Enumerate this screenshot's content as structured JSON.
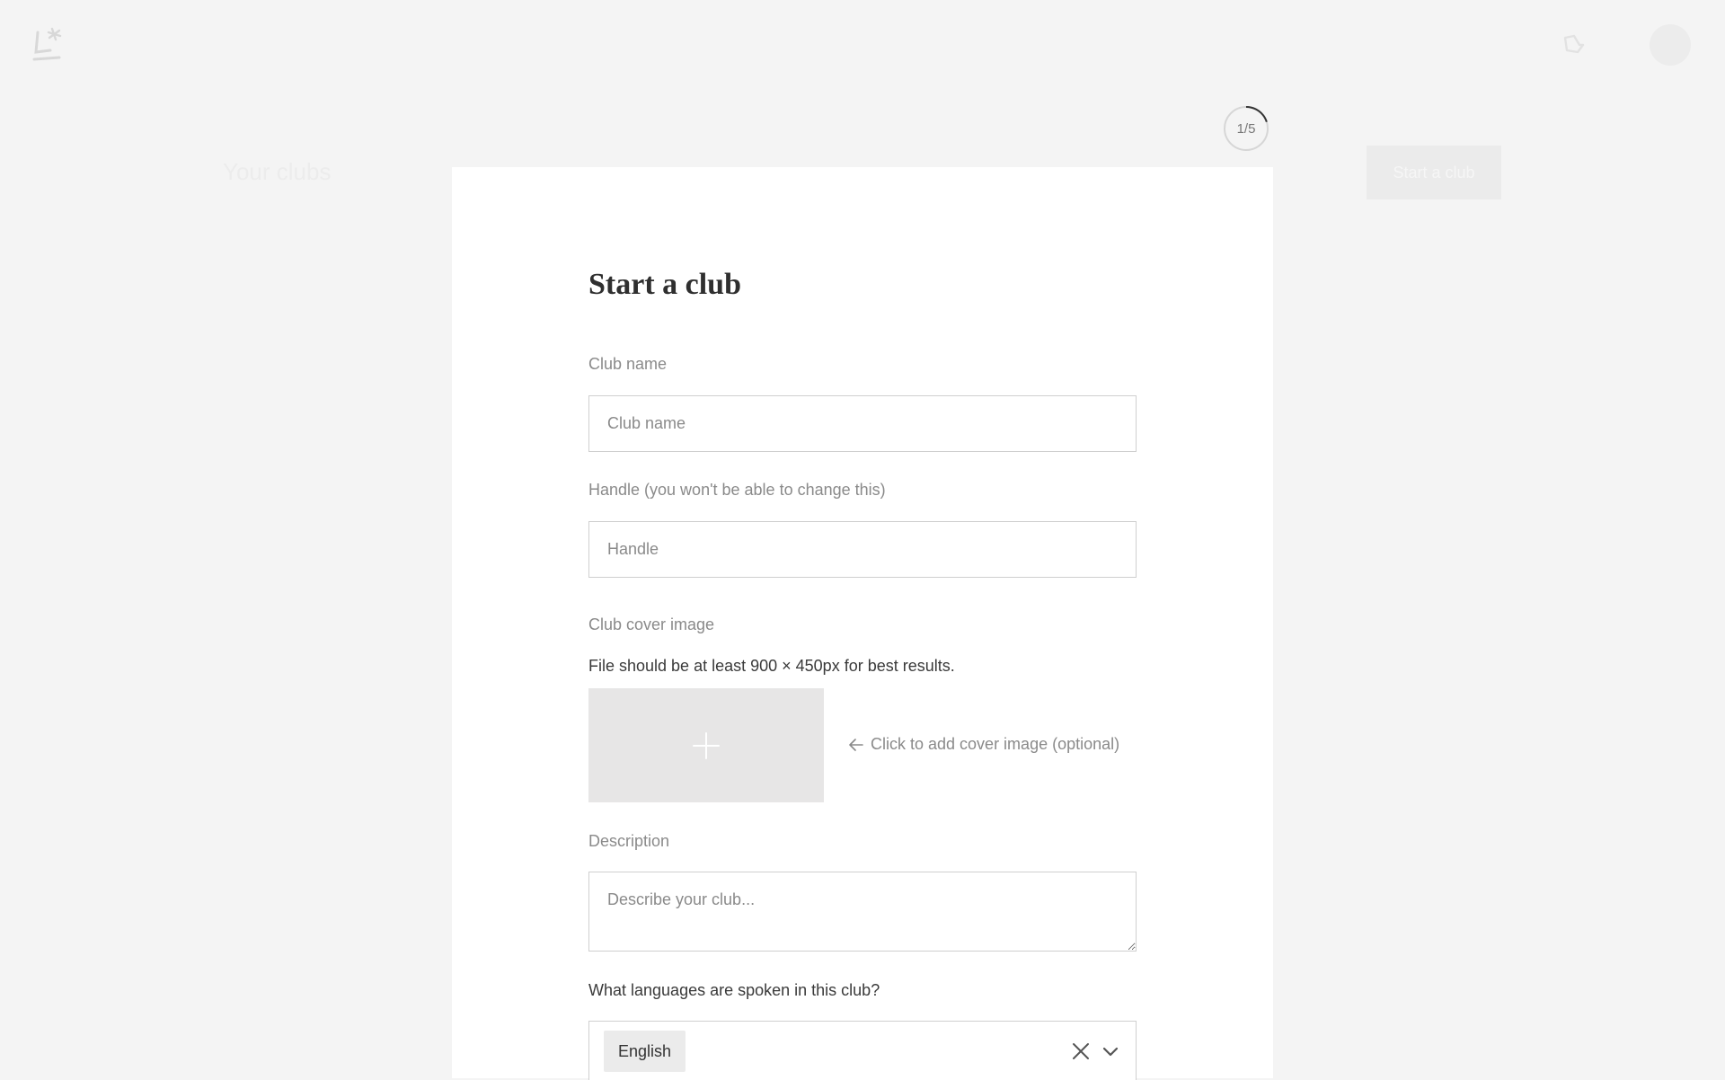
{
  "background": {
    "section_title": "Your clubs",
    "start_button_label": "Start a club"
  },
  "progress": {
    "label": "1/5",
    "fraction": 0.2
  },
  "form": {
    "title": "Start a club",
    "club_name": {
      "label": "Club name",
      "placeholder": "Club name",
      "value": ""
    },
    "handle": {
      "label": "Handle (you won't be able to change this)",
      "placeholder": "Handle",
      "value": ""
    },
    "cover_image": {
      "label": "Club cover image",
      "hint_size": "File should be at least 900 × 450px for best results.",
      "add_hint": "Click to add cover image (optional)"
    },
    "description": {
      "label": "Description",
      "placeholder": "Describe your club...",
      "value": ""
    },
    "languages": {
      "label": "What languages are spoken in this club?",
      "selected": [
        "English"
      ]
    }
  },
  "icons": {
    "logo": "letterboxd-like-logo",
    "notification": "notification-icon",
    "avatar": "avatar",
    "add": "plus-icon",
    "arrow": "arrow-left-icon",
    "clear": "close-icon",
    "dropdown": "chevron-down-icon"
  }
}
